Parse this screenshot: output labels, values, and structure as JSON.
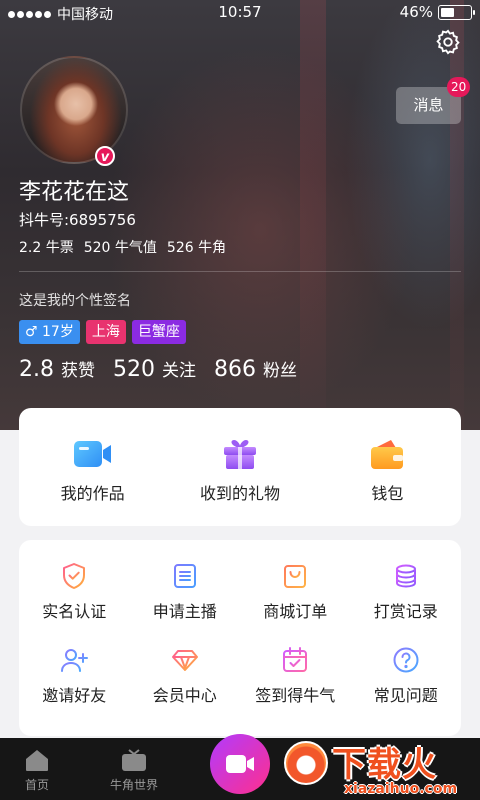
{
  "status_bar": {
    "carrier": "中国移动",
    "time": "10:57",
    "battery": "46%",
    "battery_level": 0.46
  },
  "profile": {
    "name": "李花花在这",
    "id_label": "抖牛号:6895756",
    "ticket_value": "2.2",
    "ticket_label": "牛票",
    "energy_value": "520",
    "energy_label": "牛气值",
    "horn_value": "526",
    "horn_label": "牛角",
    "signature": "这是我的个性签名",
    "verified_badge": "v",
    "tags": {
      "gender": "♂ 17岁",
      "city": "上海",
      "zodiac": "巨蟹座"
    },
    "likes_value": "2.8",
    "likes_label": "获赞",
    "following_value": "520",
    "following_label": "关注",
    "fans_value": "866",
    "fans_label": "粉丝"
  },
  "message_button": {
    "label": "消息",
    "count": "20"
  },
  "quick_actions": {
    "works": "我的作品",
    "gifts": "收到的礼物",
    "wallet": "钱包"
  },
  "services": {
    "realname": "实名认证",
    "apply_host": "申请主播",
    "mall_orders": "商城订单",
    "tip_records": "打赏记录",
    "invite": "邀请好友",
    "vip_center": "会员中心",
    "checkin": "签到得牛气",
    "faq": "常见问题"
  },
  "tabbar": {
    "home": "首页",
    "world": "牛角世界"
  },
  "watermark": {
    "big": "下载火",
    "url": "xiazaihuo.com"
  },
  "colors": {
    "accent_pink": "#e6195a",
    "tag_gender": "#3a8ff0",
    "tag_city": "#e8336f",
    "tag_zodiac": "#8b2be2"
  }
}
